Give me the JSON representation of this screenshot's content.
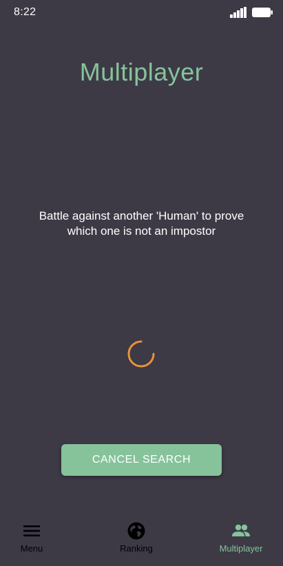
{
  "status_bar": {
    "time": "8:22",
    "signal_icon": "cellular-signal-icon",
    "battery_icon": "battery-icon"
  },
  "title": "Multiplayer",
  "description": "Battle against another 'Human' to prove which one is not an impostor",
  "loading_indicator": "loading-spinner-icon",
  "cancel_button": {
    "label": "CANCEL SEARCH"
  },
  "bottom_nav": {
    "items": [
      {
        "label": "Menu",
        "icon": "hamburger-menu-icon",
        "active": false
      },
      {
        "label": "Ranking",
        "icon": "globe-icon",
        "active": false
      },
      {
        "label": "Multiplayer",
        "icon": "people-icon",
        "active": true
      }
    ]
  },
  "colors": {
    "background": "#3d3a46",
    "accent": "#86c39b",
    "spinner": "#e8923a",
    "text": "#ffffff",
    "nav_inactive": "#000000"
  }
}
